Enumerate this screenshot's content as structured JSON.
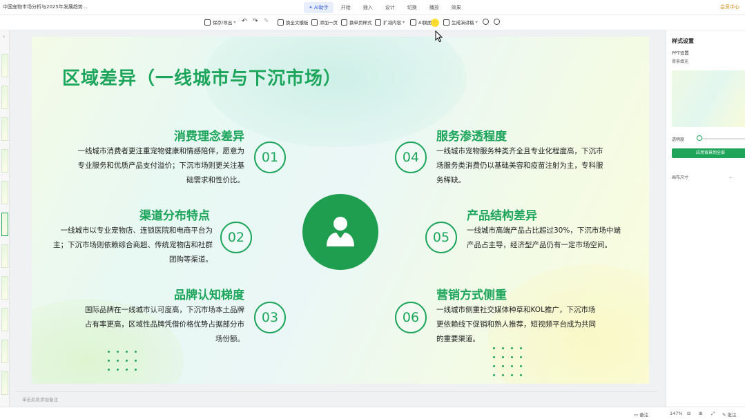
{
  "app": {
    "doc_title": "中国宠物市场分析与2025年发展趋势...",
    "top_right": "会员中心"
  },
  "menu": [
    {
      "label": "AI助手",
      "active": true
    },
    {
      "label": "开始",
      "active": false
    },
    {
      "label": "插入",
      "active": false
    },
    {
      "label": "设计",
      "active": false
    },
    {
      "label": "切换",
      "active": false
    },
    {
      "label": "播放",
      "active": false
    },
    {
      "label": "效果",
      "active": false
    }
  ],
  "toolbar": {
    "save_export": "保存/导出",
    "replace_template": "换全文模板",
    "add_page": "添加一页",
    "change_style": "换单页样式",
    "expand_content": "扩减内容",
    "ai_image": "AI换图",
    "generate_speech": "生成演讲稿"
  },
  "slide": {
    "title": "区域差异（一线城市与下沉市场）",
    "items": [
      {
        "num": "01",
        "title": "消费理念差异",
        "body": "一线城市消费者更注重宠物健康和情感陪伴，愿意为专业服务和优质产品支付溢价；下沉市场则更关注基础需求和性价比。"
      },
      {
        "num": "02",
        "title": "渠道分布特点",
        "body": "一线城市以专业宠物店、连锁医院和电商平台为主；下沉市场则依赖综合商超、传统宠物店和社群团购等渠道。"
      },
      {
        "num": "03",
        "title": "品牌认知梯度",
        "body": "国际品牌在一线城市认可度高，下沉市场本土品牌占有率更高，区域性品牌凭借价格优势占据部分市场份额。"
      },
      {
        "num": "04",
        "title": "服务渗透程度",
        "body": "一线城市宠物服务种类齐全且专业化程度高，下沉市场服务类消费仍以基础美容和疫苗注射为主，专科服务稀缺。"
      },
      {
        "num": "05",
        "title": "产品结构差异",
        "body": "一线城市高端产品占比超过30%，下沉市场中端产品占主导，经济型产品仍有一定市场空间。"
      },
      {
        "num": "06",
        "title": "营销方式侧重",
        "body": "一线城市侧重社交媒体种草和KOL推广，下沉市场更依赖线下促销和熟人推荐，短视频平台成为共同的重要渠道。"
      }
    ]
  },
  "notes_placeholder": "单击此处添加备注",
  "panel": {
    "title": "样式设置",
    "ppt_settings": "PPT设置",
    "background_fill": "背景填充",
    "transparency": "透明度",
    "apply_all": "应用背景到全部",
    "canvas_size": "画布尺寸"
  },
  "status": {
    "zoom": "147%",
    "notes": "备注",
    "comments": "批注"
  },
  "colors": {
    "accent": "#1da55b",
    "circle": "#1f9e4f"
  }
}
